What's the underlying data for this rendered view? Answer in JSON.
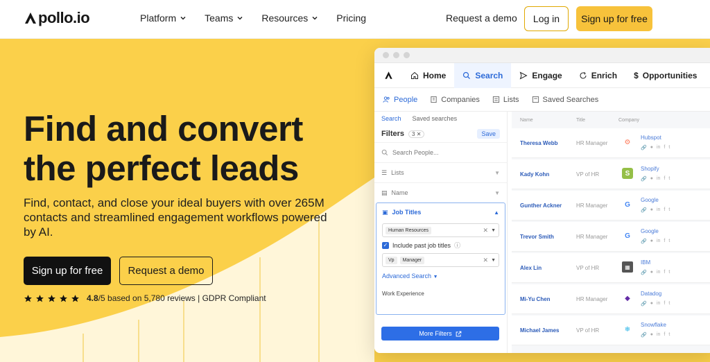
{
  "nav": {
    "logo": "Apollo.io",
    "menu": [
      {
        "label": "Platform",
        "has_dropdown": true
      },
      {
        "label": "Teams",
        "has_dropdown": true
      },
      {
        "label": "Resources",
        "has_dropdown": true
      },
      {
        "label": "Pricing",
        "has_dropdown": false
      }
    ],
    "request_demo": "Request a demo",
    "login": "Log in",
    "signup": "Sign up for free"
  },
  "hero": {
    "headline_line1": "Find and convert",
    "headline_line2": "the perfect leads",
    "subhead": "Find, contact, and close your ideal buyers with over 265M contacts and streamlined engagement workflows powered by AI.",
    "primary_cta": "Sign up for free",
    "secondary_cta": "Request a demo",
    "rating_score": "4.8",
    "rating_text": "/5 based on 5,780 reviews | GDPR Compliant",
    "star_count": 5,
    "accent_color": "#fbd04a"
  },
  "app": {
    "nav_tabs": [
      {
        "label": "Home",
        "icon": "home-icon"
      },
      {
        "label": "Search",
        "icon": "search-icon",
        "active": true
      },
      {
        "label": "Engage",
        "icon": "send-icon"
      },
      {
        "label": "Enrich",
        "icon": "refresh-icon"
      },
      {
        "label": "Opportunities",
        "icon": "dollar-icon"
      }
    ],
    "sub_tabs": [
      {
        "label": "People",
        "icon": "people-icon",
        "active": true
      },
      {
        "label": "Companies",
        "icon": "building-icon"
      },
      {
        "label": "Lists",
        "icon": "list-icon"
      },
      {
        "label": "Saved Searches",
        "icon": "bookmark-icon"
      }
    ],
    "filters": {
      "search_tab": "Search",
      "saved_tab": "Saved searches",
      "title": "Filters",
      "count": "3",
      "save": "Save",
      "search_placeholder": "Search People...",
      "lists": "Lists",
      "name": "Name",
      "job_titles": "Job Titles",
      "chip_human_resources": "Human Resources",
      "include_past": "Include past job titles",
      "chip_vp": "Vp",
      "chip_manager": "Manager",
      "advanced_search": "Advanced Search",
      "work_experience": "Work Experience",
      "more_filters": "More Filters"
    },
    "table_headers": {
      "name": "Name",
      "title": "Title",
      "company": "Company"
    },
    "rows": [
      {
        "name": "Theresa Webb",
        "title": "HR Manager",
        "company": "Hubspot",
        "logo_color": "#ff7a59",
        "logo_char": "⚙"
      },
      {
        "name": "Kady Kohn",
        "title": "VP of HR",
        "company": "Shopify",
        "logo_color": "#95bf47",
        "logo_char": "S"
      },
      {
        "name": "Gunther Ackner",
        "title": "HR Manager",
        "company": "Google",
        "logo_color": "#4285f4",
        "logo_char": "G"
      },
      {
        "name": "Trevor Smith",
        "title": "HR Manager",
        "company": "Google",
        "logo_color": "#4285f4",
        "logo_char": "G"
      },
      {
        "name": "Alex Lin",
        "title": "VP of HR",
        "company": "IBM",
        "logo_color": "#555555",
        "logo_char": "▦"
      },
      {
        "name": "Mi-Yu Chen",
        "title": "HR Manager",
        "company": "Datadog",
        "logo_color": "#632ca6",
        "logo_char": "◆"
      },
      {
        "name": "Michael James",
        "title": "VP of HR",
        "company": "Snowflake",
        "logo_color": "#29b5e8",
        "logo_char": "❄"
      }
    ]
  }
}
